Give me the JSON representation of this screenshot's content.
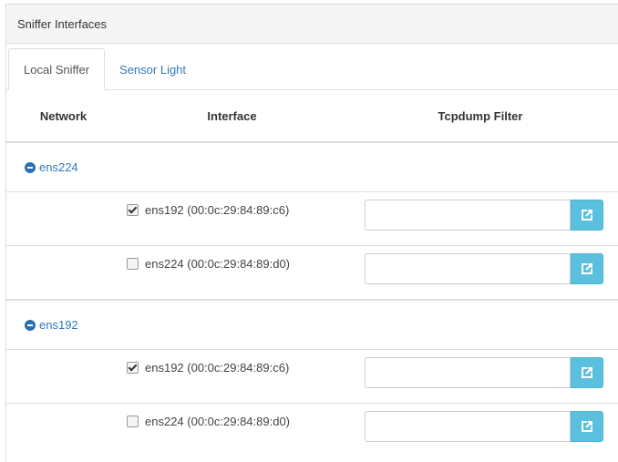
{
  "panel": {
    "title": "Sniffer Interfaces"
  },
  "tabs": [
    {
      "label": "Local Sniffer",
      "active": true
    },
    {
      "label": "Sensor Light",
      "active": false
    }
  ],
  "table": {
    "headers": {
      "network": "Network",
      "interface": "Interface",
      "filter": "Tcpdump Filter"
    },
    "groups": [
      {
        "network": "ens224",
        "rows": [
          {
            "interface": "ens192 (00:0c:29:84:89:c6)",
            "checked": true,
            "filter": ""
          },
          {
            "interface": "ens224 (00:0c:29:84:89:d0)",
            "checked": false,
            "filter": ""
          }
        ]
      },
      {
        "network": "ens192",
        "rows": [
          {
            "interface": "ens192 (00:0c:29:84:89:c6)",
            "checked": true,
            "filter": ""
          },
          {
            "interface": "ens224 (00:0c:29:84:89:d0)",
            "checked": false,
            "filter": ""
          }
        ]
      }
    ]
  },
  "icons": {
    "collapse": "minus-circle-icon",
    "apply": "external-link-icon"
  },
  "colors": {
    "link": "#337ab7",
    "button": "#5bc0de",
    "header_bg": "#f5f5f5"
  }
}
